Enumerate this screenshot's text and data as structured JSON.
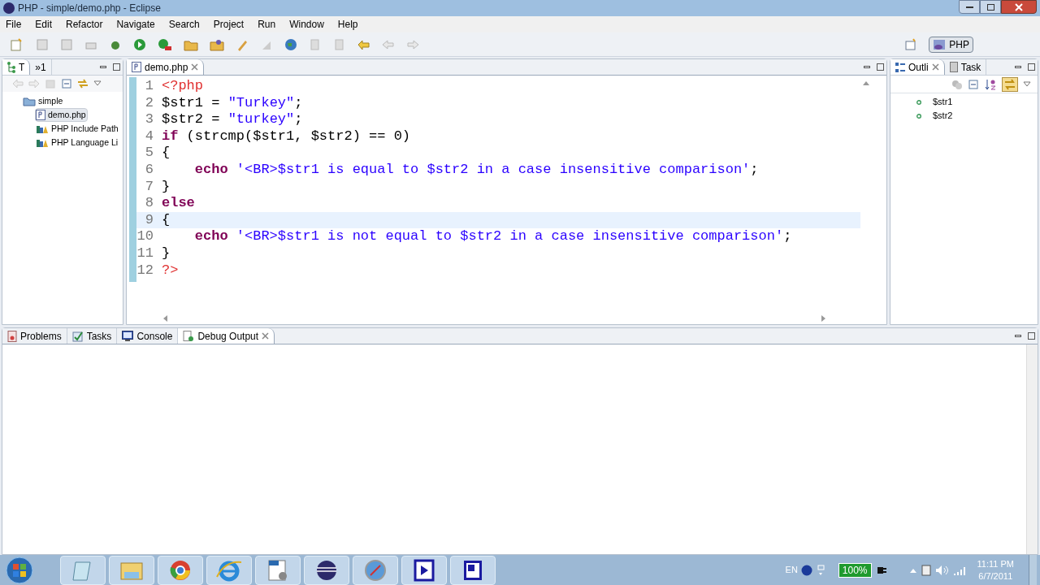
{
  "window": {
    "title": "PHP - simple/demo.php - Eclipse"
  },
  "menu": [
    "File",
    "Edit",
    "Refactor",
    "Navigate",
    "Search",
    "Project",
    "Run",
    "Window",
    "Help"
  ],
  "perspective": {
    "label": "PHP",
    "selected": true
  },
  "left_panel": {
    "tabs": [
      {
        "label": "T",
        "selected": true
      },
      {
        "label": "»1",
        "selected": false
      }
    ],
    "tree": [
      {
        "label": "simple",
        "kind": "project",
        "children": [
          {
            "label": "demo.php",
            "kind": "file",
            "selected": true
          },
          {
            "label": "PHP Include Path",
            "kind": "library",
            "selected": false
          },
          {
            "label": "PHP Language Li",
            "kind": "library",
            "selected": false
          }
        ]
      }
    ]
  },
  "editor": {
    "tab": {
      "label": "demo.php",
      "selected": true
    },
    "lines": [
      {
        "number": "1",
        "current": false,
        "tokens": [
          {
            "kind": "tag",
            "text": "<?php"
          }
        ]
      },
      {
        "number": "2",
        "current": false,
        "tokens": [
          {
            "kind": "plain",
            "text": "$str1 = "
          },
          {
            "kind": "string",
            "text": "\"Turkey\""
          },
          {
            "kind": "plain",
            "text": ";"
          }
        ]
      },
      {
        "number": "3",
        "current": false,
        "tokens": [
          {
            "kind": "plain",
            "text": "$str2 = "
          },
          {
            "kind": "string",
            "text": "\"turkey\""
          },
          {
            "kind": "plain",
            "text": ";"
          }
        ]
      },
      {
        "number": "4",
        "current": false,
        "tokens": [
          {
            "kind": "keyword",
            "text": "if"
          },
          {
            "kind": "plain",
            "text": " (strcmp($str1, $str2) == 0)"
          }
        ]
      },
      {
        "number": "5",
        "current": false,
        "tokens": [
          {
            "kind": "plain",
            "text": "{"
          }
        ]
      },
      {
        "number": "6",
        "current": false,
        "indent": true,
        "tokens": [
          {
            "kind": "keyword",
            "text": "echo "
          },
          {
            "kind": "string",
            "text": "'<BR>$str1 is equal to $str2 in a case insensitive comparison'"
          },
          {
            "kind": "plain",
            "text": ";"
          }
        ]
      },
      {
        "number": "7",
        "current": false,
        "tokens": [
          {
            "kind": "plain",
            "text": "}"
          }
        ]
      },
      {
        "number": "8",
        "current": false,
        "tokens": [
          {
            "kind": "keyword",
            "text": "else"
          }
        ]
      },
      {
        "number": "9",
        "current": true,
        "tokens": [
          {
            "kind": "plain",
            "text": "{"
          }
        ]
      },
      {
        "number": "10",
        "current": false,
        "indent": true,
        "tokens": [
          {
            "kind": "keyword",
            "text": "echo "
          },
          {
            "kind": "string",
            "text": "'<BR>$str1 is not equal to $str2 in a case insensitive comparison'"
          },
          {
            "kind": "plain",
            "text": ";"
          }
        ]
      },
      {
        "number": "11",
        "current": false,
        "tokens": [
          {
            "kind": "plain",
            "text": "}"
          }
        ]
      },
      {
        "number": "12",
        "current": false,
        "tokens": [
          {
            "kind": "tag",
            "text": "?>"
          }
        ]
      }
    ]
  },
  "outline": {
    "tabs": [
      {
        "label": "Outli",
        "selected": true
      },
      {
        "label": "Task",
        "selected": false
      }
    ],
    "items": [
      "$str1",
      "$str2"
    ]
  },
  "bottom_panel": {
    "tabs": [
      {
        "label": "Problems",
        "selected": false
      },
      {
        "label": "Tasks",
        "selected": false
      },
      {
        "label": "Console",
        "selected": false
      },
      {
        "label": "Debug Output",
        "selected": true
      }
    ]
  },
  "taskbar": {
    "language": "EN",
    "battery": "100%",
    "time": "11:11 PM",
    "date": "6/7/2011"
  }
}
